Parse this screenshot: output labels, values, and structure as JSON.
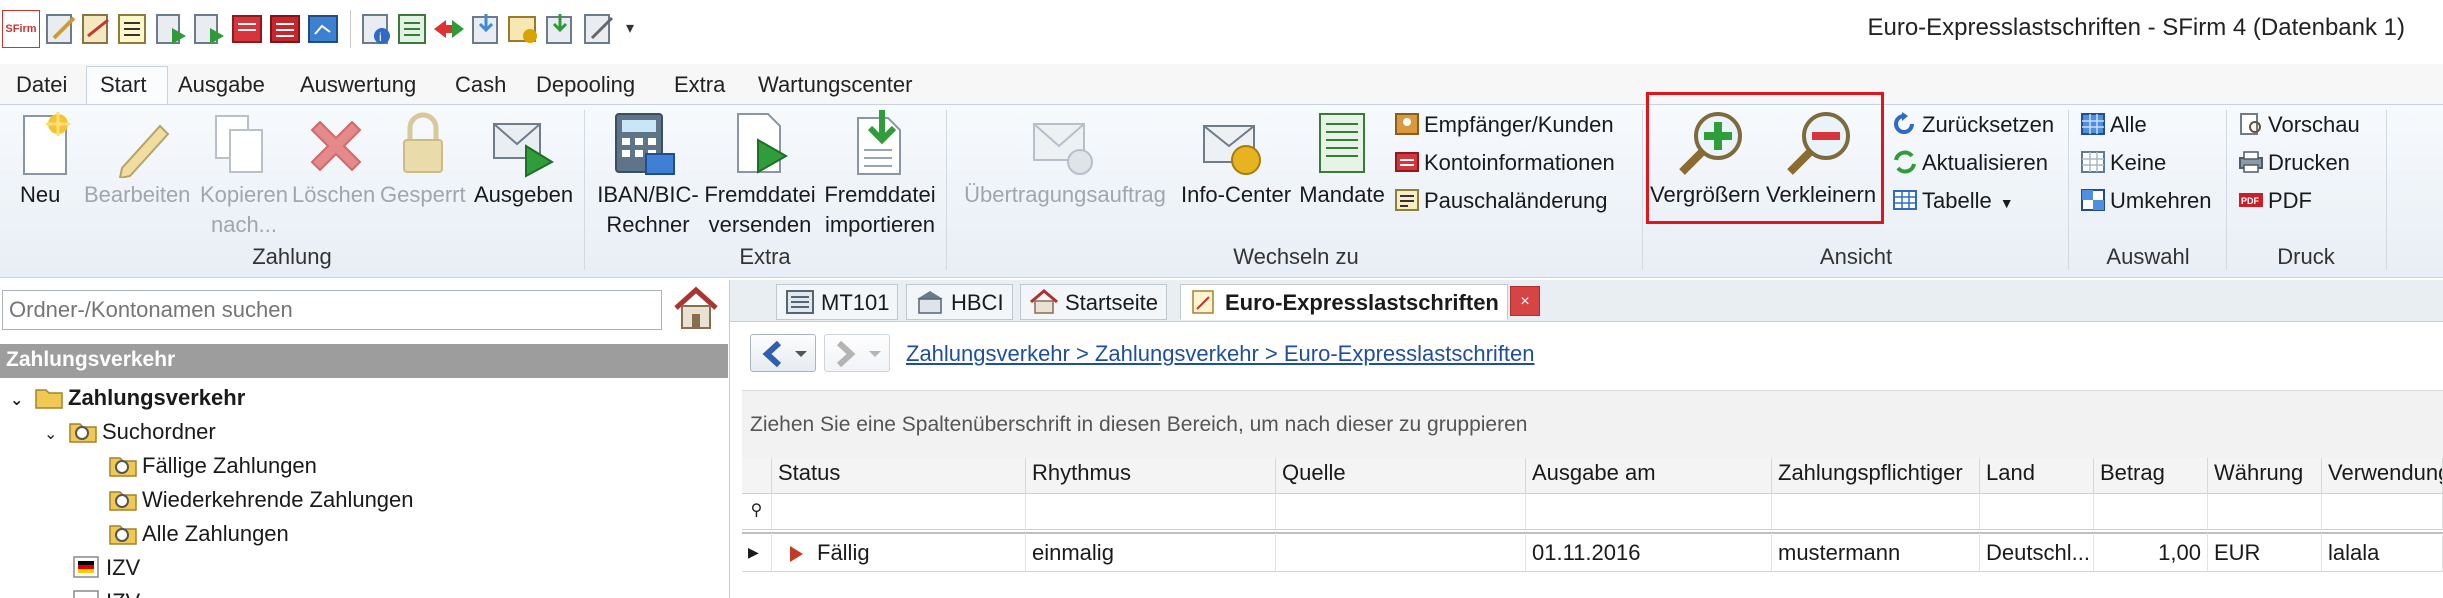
{
  "app": {
    "title": "Euro-Expresslastschriften - SFirm 4 (Datenbank 1)",
    "logo_text": "SFirm"
  },
  "menu": [
    "Datei",
    "Start",
    "Ausgabe",
    "Auswertung",
    "Cash",
    "Depooling",
    "Extra",
    "Wartungscenter"
  ],
  "ribbon": {
    "zahlung": {
      "group_label": "Zahlung",
      "neu": "Neu",
      "bearbeiten": "Bearbeiten",
      "kopieren": "Kopieren nach...",
      "loeschen": "Löschen",
      "gesperrt": "Gesperrt",
      "ausgeben": "Ausgeben"
    },
    "extra": {
      "group_label": "Extra",
      "iban_rechner": "IBAN/BIC-Rechner",
      "fremddatei_versenden": "Fremddatei versenden",
      "fremddatei_importieren": "Fremddatei importieren"
    },
    "wechseln": {
      "group_label": "Wechseln zu",
      "uebertragungsauftrag": "Übertragungsauftrag",
      "info_center": "Info-Center",
      "mandate": "Mandate",
      "empfaenger": "Empfänger/Kunden",
      "kontoinformationen": "Kontoinformationen",
      "pauschalaenderung": "Pauschaländerung"
    },
    "ansicht": {
      "group_label": "Ansicht",
      "vergroessern": "Vergrößern",
      "verkleinern": "Verkleinern",
      "zuruecksetzen": "Zurücksetzen",
      "aktualisieren": "Aktualisieren",
      "tabelle": "Tabelle"
    },
    "auswahl": {
      "group_label": "Auswahl",
      "alle": "Alle",
      "keine": "Keine",
      "umkehren": "Umkehren"
    },
    "druck": {
      "group_label": "Druck",
      "vorschau": "Vorschau",
      "drucken": "Drucken",
      "pdf": "PDF"
    }
  },
  "left_panel": {
    "search_placeholder": "Ordner-/Kontonamen suchen",
    "section_title": "Zahlungsverkehr",
    "tree": [
      {
        "label": "Zahlungsverkehr",
        "icon": "folder-open-icon"
      },
      {
        "label": "Suchordner",
        "icon": "search-folder-icon"
      },
      {
        "label": "Fällige Zahlungen",
        "icon": "search-folder-icon"
      },
      {
        "label": "Wiederkehrende Zahlungen",
        "icon": "search-folder-icon"
      },
      {
        "label": "Alle Zahlungen",
        "icon": "search-folder-icon"
      },
      {
        "label": "IZV",
        "icon": "flag-de-icon"
      },
      {
        "label": "IZV",
        "icon": "flag-de-icon"
      }
    ]
  },
  "tabs": [
    {
      "label": "MT101",
      "icon": "mt101-icon"
    },
    {
      "label": "HBCI",
      "icon": "bank-icon"
    },
    {
      "label": "Startseite",
      "icon": "home-icon"
    },
    {
      "label": "Euro-Expresslastschriften",
      "icon": "document-icon"
    }
  ],
  "tab_close_label": "×",
  "breadcrumb": "Zahlungsverkehr > Zahlungsverkehr > Euro-Expresslastschriften",
  "group_hint": "Ziehen Sie eine Spaltenüberschrift in diesen Bereich, um nach dieser zu gruppieren",
  "table": {
    "columns": [
      "Status",
      "Rhythmus",
      "Quelle",
      "Ausgabe am",
      "Zahlungspflichtiger",
      "Land",
      "Betrag",
      "Währung",
      "Verwendung"
    ],
    "rows": [
      [
        "Fällig",
        "einmalig",
        "",
        "01.11.2016",
        "mustermann",
        "Deutschl...",
        "1,00",
        "EUR",
        "lalala"
      ]
    ]
  },
  "colors": {
    "highlight": "#e2141c",
    "link": "#1f4e9e",
    "section_head": "#9d9d9d"
  }
}
